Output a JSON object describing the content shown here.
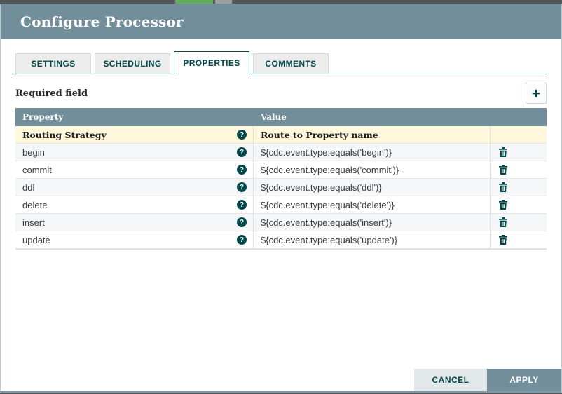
{
  "window": {
    "title": "Configure Processor"
  },
  "tabs": [
    {
      "label": "SETTINGS",
      "active": false
    },
    {
      "label": "SCHEDULING",
      "active": false
    },
    {
      "label": "PROPERTIES",
      "active": true
    },
    {
      "label": "COMMENTS",
      "active": false
    }
  ],
  "toolbar": {
    "required_label": "Required field",
    "add_button_glyph": "+"
  },
  "table": {
    "columns": [
      "Property",
      "Value"
    ],
    "help_glyph": "?",
    "rows": [
      {
        "property": "Routing Strategy",
        "value": "Route to Property name",
        "required": true,
        "deletable": false
      },
      {
        "property": "begin",
        "value": "${cdc.event.type:equals('begin')}",
        "required": false,
        "deletable": true
      },
      {
        "property": "commit",
        "value": "${cdc.event.type:equals('commit')}",
        "required": false,
        "deletable": true
      },
      {
        "property": "ddl",
        "value": "${cdc.event.type:equals('ddl')}",
        "required": false,
        "deletable": true
      },
      {
        "property": "delete",
        "value": "${cdc.event.type:equals('delete')}",
        "required": false,
        "deletable": true
      },
      {
        "property": "insert",
        "value": "${cdc.event.type:equals('insert')}",
        "required": false,
        "deletable": true
      },
      {
        "property": "update",
        "value": "${cdc.event.type:equals('update')}",
        "required": false,
        "deletable": true
      }
    ]
  },
  "footer": {
    "cancel_label": "CANCEL",
    "apply_label": "APPLY"
  },
  "colors": {
    "header_bg": "#728E9B",
    "accent_teal": "#004849",
    "required_row_bg": "#FFF8DC",
    "cancel_bg": "#E3E8EB",
    "canvas_green": "#5fae5f"
  }
}
